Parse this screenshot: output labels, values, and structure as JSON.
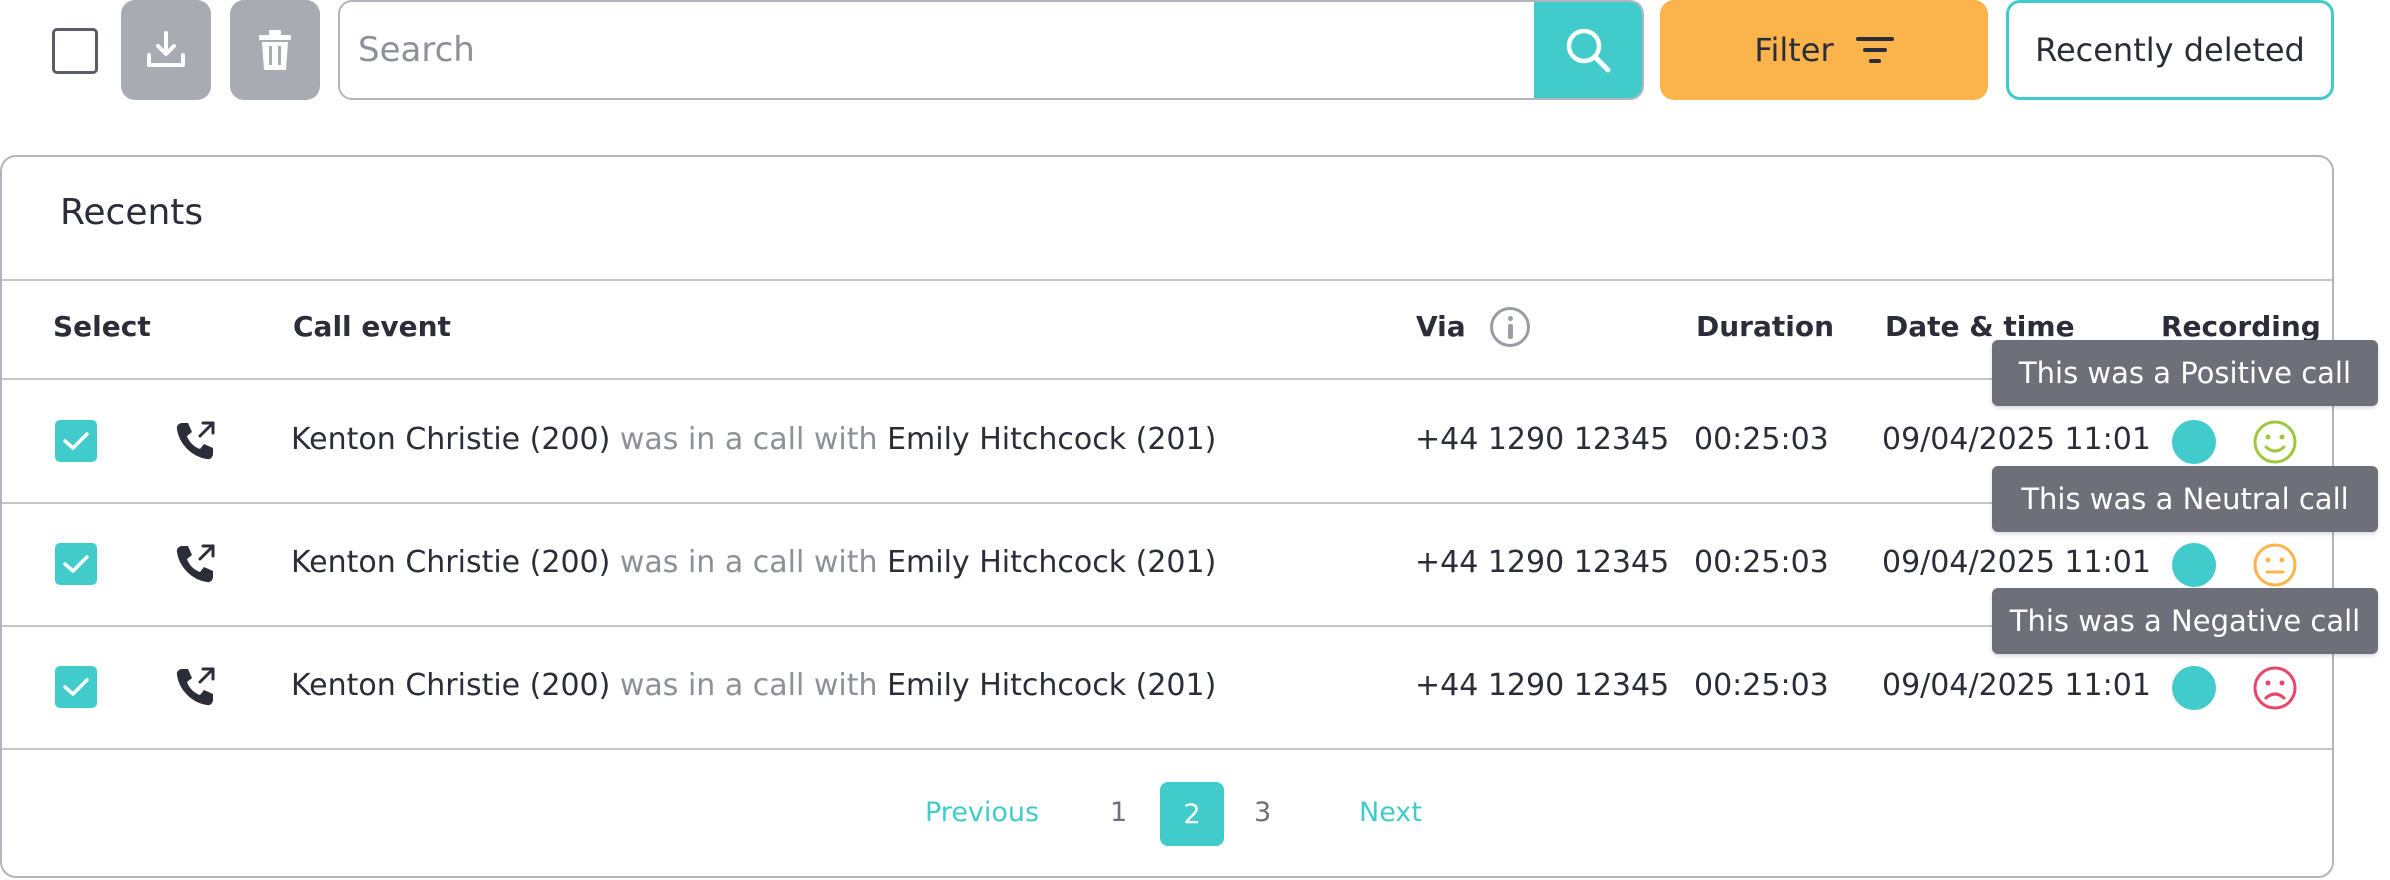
{
  "search": {
    "placeholder": "Search",
    "value": ""
  },
  "toolbar": {
    "download_icon": "download-icon",
    "delete_icon": "trash-icon",
    "filter_label": "Filter",
    "recently_deleted_label": "Recently deleted"
  },
  "card": {
    "title": "Recents"
  },
  "table": {
    "headers": {
      "select": "Select",
      "call_event": "Call event",
      "via": "Via",
      "duration": "Duration",
      "date_time": "Date & time",
      "recording": "Recording"
    },
    "rows": [
      {
        "caller": "Kenton Christie (200)",
        "connector": "was in a call with",
        "callee": "Emily Hitchcock (201)",
        "via": "+44 1290 12345",
        "duration": "00:25:03",
        "datetime": "09/04/2025 11:01",
        "sentiment": "positive",
        "tooltip": "This was a Positive call",
        "checked": true
      },
      {
        "caller": "Kenton Christie (200)",
        "connector": "was in a call with",
        "callee": "Emily Hitchcock (201)",
        "via": "+44 1290 12345",
        "duration": "00:25:03",
        "datetime": "09/04/2025 11:01",
        "sentiment": "neutral",
        "tooltip": "This was a Neutral call",
        "checked": true
      },
      {
        "caller": "Kenton Christie (200)",
        "connector": "was in a call with",
        "callee": "Emily Hitchcock (201)",
        "via": "+44 1290 12345",
        "duration": "00:25:03",
        "datetime": "09/04/2025 11:01",
        "sentiment": "negative",
        "tooltip": "This was a Negative call",
        "checked": true
      }
    ]
  },
  "pagination": {
    "previous": "Previous",
    "pages": [
      "1",
      "2",
      "3"
    ],
    "current": "2",
    "next": "Next"
  },
  "colors": {
    "accent": "#42cbcb",
    "filter": "#fbb44c",
    "positive": "#9dc83c",
    "neutral": "#fbb44c",
    "negative": "#e8456a",
    "tooltip_bg": "#6d6f79"
  }
}
